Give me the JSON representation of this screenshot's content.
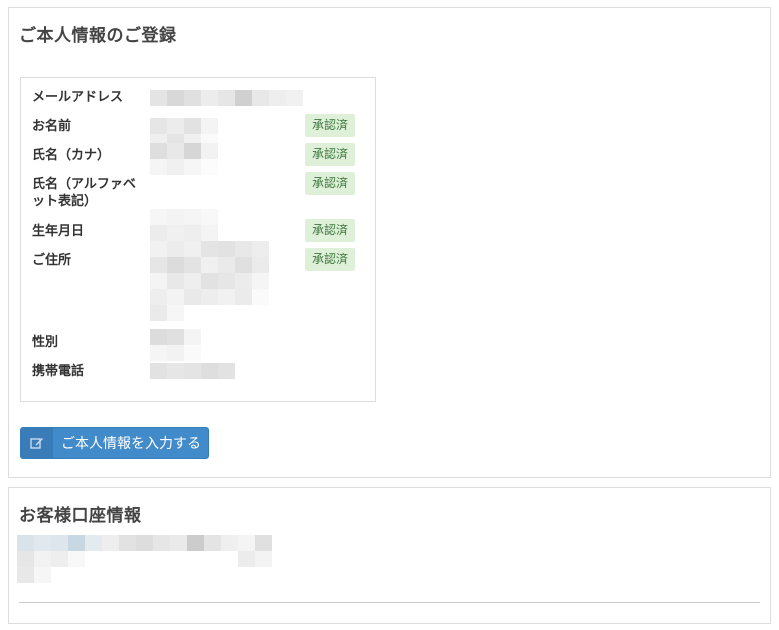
{
  "personal": {
    "title": "ご本人情報のご登録",
    "rows": [
      {
        "label": "メールアドレス",
        "badge": ""
      },
      {
        "label": "お名前",
        "badge": "承認済"
      },
      {
        "label": "氏名（カナ）",
        "badge": "承認済"
      },
      {
        "label": "氏名（アルファベット表記）",
        "badge": "承認済"
      },
      {
        "label": "生年月日",
        "badge": "承認済"
      },
      {
        "label": "ご住所",
        "badge": "承認済"
      },
      {
        "label": "性別",
        "badge": ""
      },
      {
        "label": "携帯電話",
        "badge": ""
      }
    ],
    "input_button_label": "ご本人情報を入力する"
  },
  "account": {
    "title": "お客様口座情報"
  },
  "colors": {
    "primary": "#428bca",
    "badge_bg": "#dff0d8",
    "badge_text": "#3c763d"
  },
  "icons": {
    "edit_button_icon": "pencil-square-icon"
  }
}
